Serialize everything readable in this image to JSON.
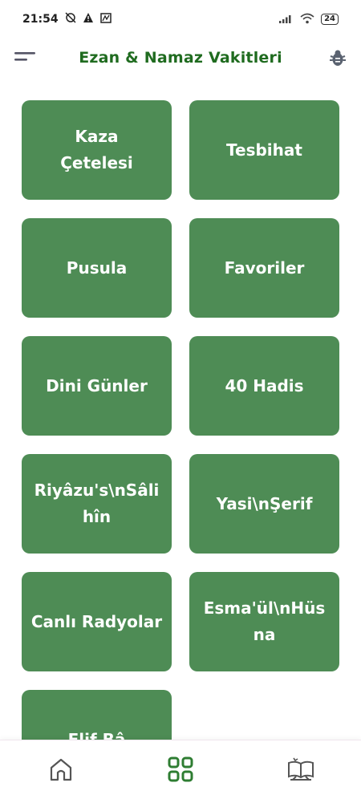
{
  "status_bar": {
    "time": "21:54",
    "battery": "24",
    "icons": [
      "alarm-off-icon",
      "warning-icon",
      "notification-icon",
      "signal-icon",
      "wifi-icon",
      "battery-icon"
    ]
  },
  "app_bar": {
    "title": "Ezan & Namaz Vakitleri",
    "icons": [
      "menu-icon",
      "bug-icon"
    ]
  },
  "tiles": [
    {
      "label": "Kaza\nÇetelesi"
    },
    {
      "label": "Tesbihat"
    },
    {
      "label": "Pusula"
    },
    {
      "label": "Favoriler"
    },
    {
      "label": "Dini Günler"
    },
    {
      "label": "40 Hadis"
    },
    {
      "label": "Riyâzu's\\nSâli\nhîn"
    },
    {
      "label": "Yasi\\nŞerif"
    },
    {
      "label": "Canlı Radyolar"
    },
    {
      "label": "Esma'ül\\nHüs\nna"
    },
    {
      "label": "Elif Bâ"
    }
  ],
  "bottom_nav": {
    "items": [
      "home-icon",
      "grid-icon",
      "quran-book-icon"
    ],
    "active": "grid-icon"
  },
  "colors": {
    "accent": "#1f6b1f",
    "tile": "#4e8c55",
    "nav_active": "#2e7d32",
    "nav_inactive": "#555555"
  }
}
